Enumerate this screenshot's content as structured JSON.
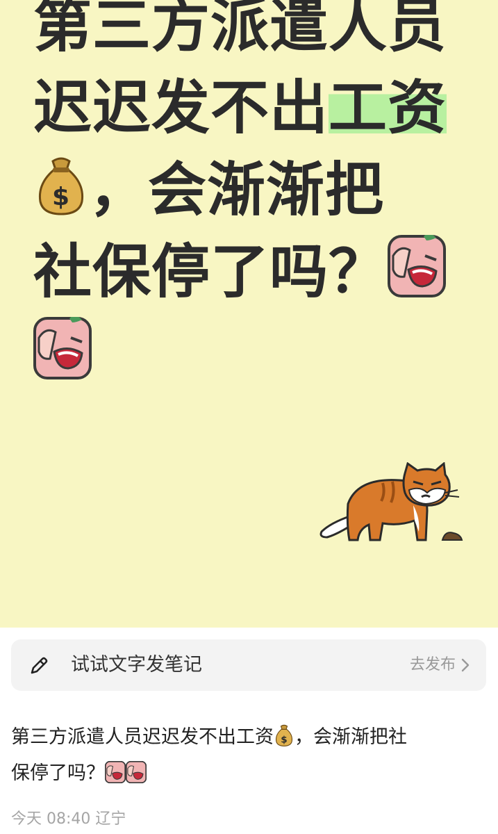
{
  "cover": {
    "title_line1": "第三方派遣人员",
    "title_line2_a": "迟迟发不出",
    "title_line2_highlight": "工资",
    "title_line3": "，会渐渐把",
    "title_line4": "社保停了吗？",
    "emojis": [
      "money-bag-icon",
      "facepalm-crying-icon",
      "facepalm-crying-icon"
    ],
    "highlight_color": "#b8f0a0",
    "background_color": "#f8f6c3"
  },
  "compose": {
    "hint": "试试文字发笔记",
    "publish_label": "去发布"
  },
  "post": {
    "text_part1": "第三方派遣人员迟迟发不出工资",
    "text_part2": "，会渐渐把社",
    "text_part3": "保停了吗？"
  },
  "meta": {
    "time_location": "今天 08:40 辽宁"
  }
}
